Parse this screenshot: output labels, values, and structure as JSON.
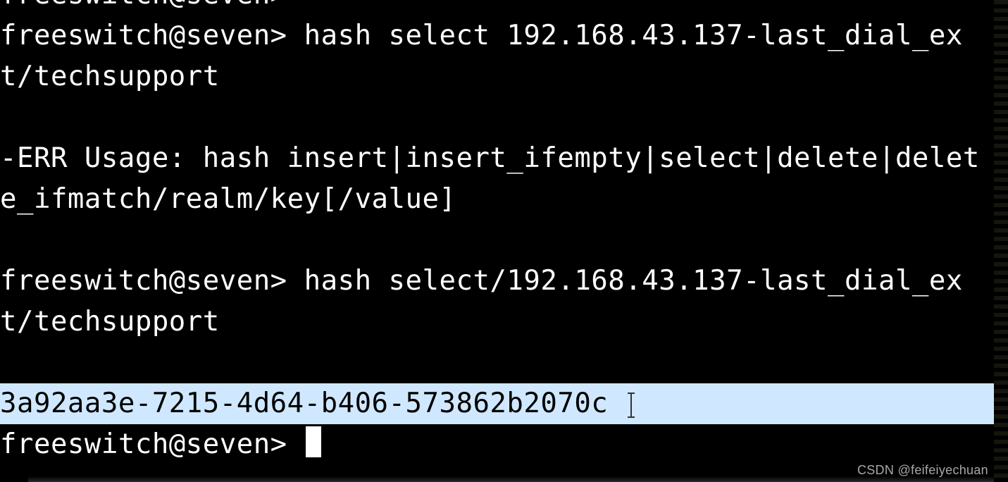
{
  "terminal": {
    "lines": [
      {
        "kind": "cut",
        "text": "freeswitch@seven>"
      },
      {
        "kind": "normal",
        "text": "freeswitch@seven> hash select 192.168.43.137-last_dial_ext/techsupport"
      },
      {
        "kind": "blank",
        "text": ""
      },
      {
        "kind": "normal",
        "text": "-ERR Usage: hash insert|insert_ifempty|select|delete|delete_ifmatch/realm/key[/value]"
      },
      {
        "kind": "blank",
        "text": ""
      },
      {
        "kind": "normal",
        "text": "freeswitch@seven> hash select/192.168.43.137-last_dial_ext/techsupport"
      },
      {
        "kind": "blank",
        "text": ""
      },
      {
        "kind": "highlight",
        "text": "3a92aa3e-7215-4d64-b406-573862b2070c ",
        "has_text_cursor": true
      },
      {
        "kind": "prompt",
        "text": "freeswitch@seven> ",
        "has_block_cursor": true
      }
    ]
  },
  "watermark": "CSDN @feifeiyechuan"
}
